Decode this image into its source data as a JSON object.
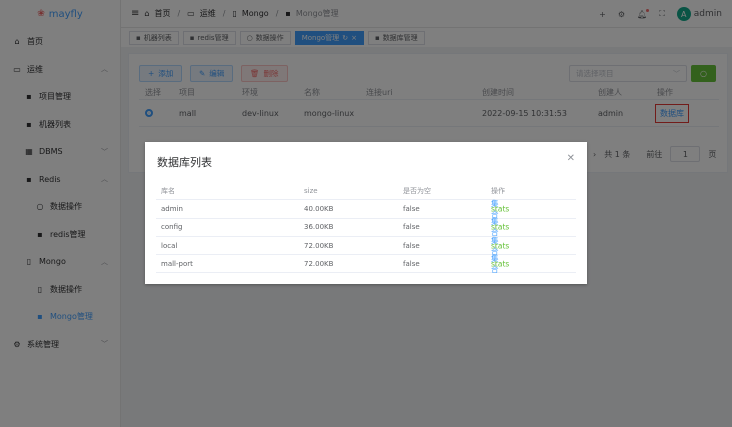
{
  "app": {
    "logo": "mayfly"
  },
  "sidebar": {
    "items": [
      {
        "label": "首页",
        "icon": "home-icon"
      },
      {
        "label": "运维",
        "icon": "monitor-icon"
      },
      {
        "label": "项目管理",
        "icon": "grid-icon"
      },
      {
        "label": "机器列表",
        "icon": "grid-icon"
      },
      {
        "label": "DBMS",
        "icon": "table-icon"
      },
      {
        "label": "Redis",
        "icon": "grid-icon"
      },
      {
        "label": "数据操作",
        "icon": "search-icon"
      },
      {
        "label": "redis管理",
        "icon": "grid-icon"
      },
      {
        "label": "Mongo",
        "icon": "document-icon"
      },
      {
        "label": "数据操作",
        "icon": "document-icon"
      },
      {
        "label": "Mongo管理",
        "icon": "grid-icon"
      },
      {
        "label": "系统管理",
        "icon": "gear-icon"
      }
    ]
  },
  "breadcrumb": [
    "首页",
    "运维",
    "Mongo",
    "Mongo管理"
  ],
  "header": {
    "user": "admin",
    "avatar": "A"
  },
  "tabs": [
    "机器列表",
    "redis管理",
    "数据操作",
    "Mongo管理",
    "数据库管理"
  ],
  "toolbar": {
    "add": "添加",
    "edit": "编辑",
    "delete": "删除",
    "project_placeholder": "请选择项目"
  },
  "table": {
    "headers": [
      "选择",
      "项目",
      "环境",
      "名称",
      "连接uri",
      "创建时间",
      "创建人",
      "操作"
    ],
    "row": {
      "project": "mall",
      "env": "dev-linux",
      "name": "mongo-linux",
      "uri": "",
      "created": "2022-09-15 10:31:53",
      "creator": "admin",
      "action": "数据库"
    }
  },
  "pagination": {
    "total": "共 1 条",
    "goto": "前往",
    "page": "1",
    "page_suffix": "页"
  },
  "dialog": {
    "title": "数据库列表",
    "headers": [
      "库名",
      "size",
      "是否为空",
      "操作"
    ],
    "rows": [
      {
        "name": "admin",
        "size": "40.00KB",
        "empty": "false"
      },
      {
        "name": "config",
        "size": "36.00KB",
        "empty": "false"
      },
      {
        "name": "local",
        "size": "72.00KB",
        "empty": "false"
      },
      {
        "name": "mall-port",
        "size": "72.00KB",
        "empty": "false"
      }
    ],
    "stats": "stats",
    "collections": "集合"
  },
  "colors": {
    "primary": "#409eff",
    "success": "#67c23a",
    "danger": "#f56c6c",
    "highlight": "#e53935"
  }
}
